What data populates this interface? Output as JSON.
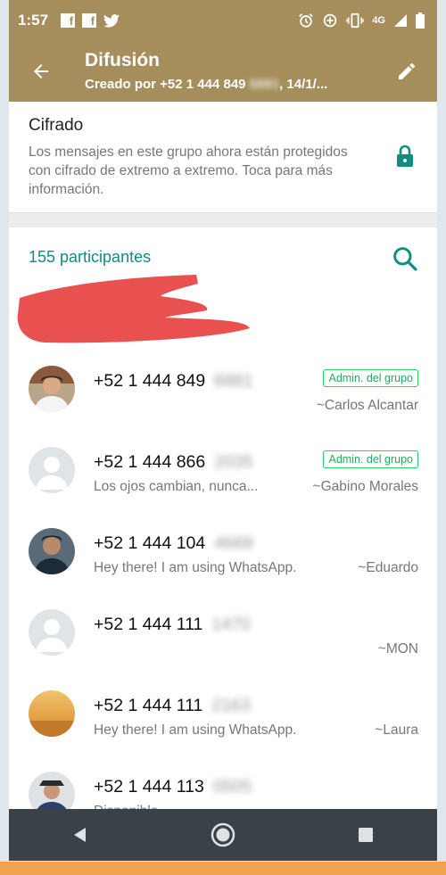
{
  "status_bar": {
    "time": "1:57",
    "network": "4G"
  },
  "app_bar": {
    "title": "Difusión",
    "subtitle_prefix": "Creado por +52 1 444 849",
    "subtitle_hidden": "6881",
    "subtitle_suffix": ", 14/1/..."
  },
  "encryption": {
    "title": "Cifrado",
    "text": "Los mensajes en este grupo ahora están protegidos con cifrado de extremo a extremo. Toca para más información."
  },
  "participants": {
    "header": "155 participantes",
    "list": [
      {
        "number": "+52 1 444 849",
        "hidden": "6881",
        "status": "",
        "alias": "~Carlos Alcantar",
        "badge": "Admin. del grupo",
        "avatar": "photo-man-white-shirt"
      },
      {
        "number": "+52 1 444 866",
        "hidden": "2035",
        "status": "Los ojos cambian, nunca...",
        "alias": "~Gabino Morales",
        "badge": "Admin. del grupo",
        "avatar": "default-avatar"
      },
      {
        "number": "+52 1 444 104",
        "hidden": "4669",
        "status": "Hey there! I am using WhatsApp.",
        "alias": "~Eduardo",
        "badge": "",
        "avatar": "photo-man-dark"
      },
      {
        "number": "+52 1 444 111",
        "hidden": "1470",
        "status": "",
        "alias": "~MON",
        "badge": "",
        "avatar": "default-avatar"
      },
      {
        "number": "+52 1 444 111",
        "hidden": "2163",
        "status": "Hey there! I am using WhatsApp.",
        "alias": "~Laura",
        "badge": "",
        "avatar": "photo-sunset"
      },
      {
        "number": "+52 1 444 113",
        "hidden": "0505",
        "status": "Disponible",
        "alias": "",
        "badge": "",
        "avatar": "photo-man-hat"
      }
    ]
  },
  "colors": {
    "header_bg": "#a58e5c",
    "accent_teal": "#128c7e",
    "badge_green": "#25d366",
    "nav_bg": "#3a4248",
    "redaction": "#e8514f"
  }
}
